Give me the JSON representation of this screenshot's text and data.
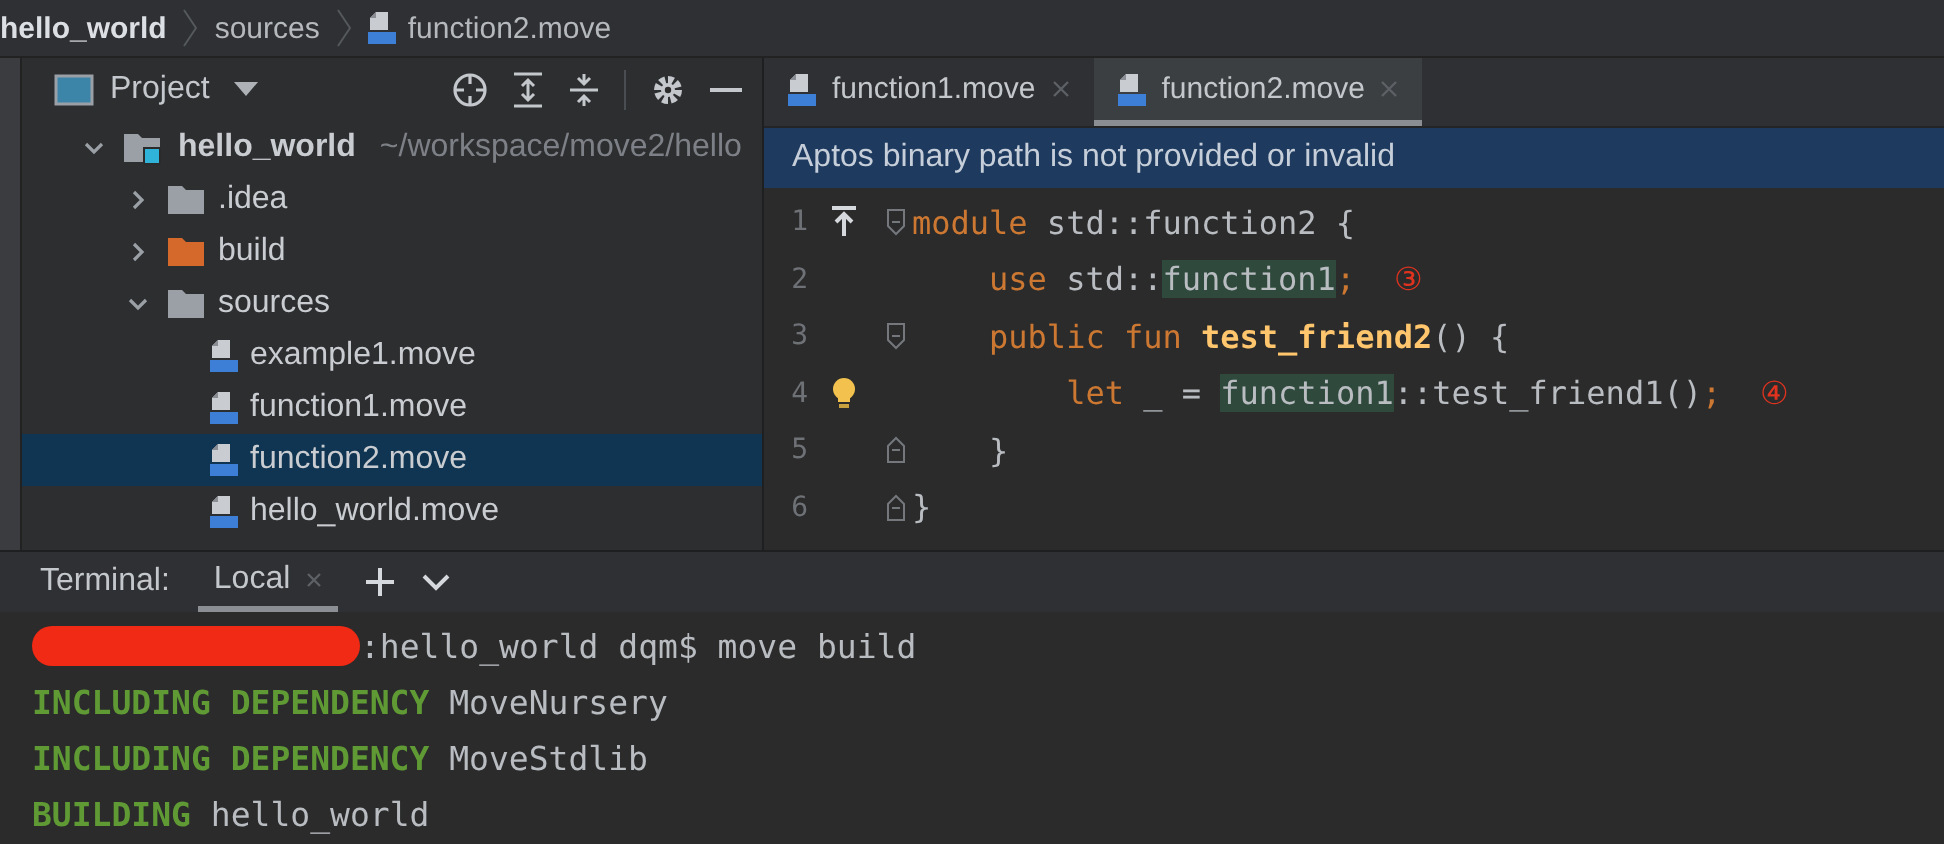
{
  "breadcrumbs": [
    {
      "label": "hello_world",
      "kind": "project"
    },
    {
      "label": "sources",
      "kind": "folder"
    },
    {
      "label": "function2.move",
      "kind": "move"
    }
  ],
  "project_panel": {
    "title": "Project",
    "tree": [
      {
        "label": "hello_world",
        "path": "~/workspace/move2/hello",
        "kind": "project",
        "expanded": true,
        "selected": false,
        "children": [
          {
            "label": ".idea",
            "kind": "folder",
            "expanded": false,
            "selected": false
          },
          {
            "label": "build",
            "kind": "excluded",
            "expanded": false,
            "selected": false
          },
          {
            "label": "sources",
            "kind": "folder",
            "expanded": true,
            "selected": false,
            "children": [
              {
                "label": "example1.move",
                "kind": "move",
                "selected": false
              },
              {
                "label": "function1.move",
                "kind": "move",
                "selected": false
              },
              {
                "label": "function2.move",
                "kind": "move",
                "selected": true
              },
              {
                "label": "hello_world.move",
                "kind": "move",
                "selected": false
              }
            ]
          }
        ]
      }
    ]
  },
  "editor": {
    "tabs": [
      {
        "label": "function1.move",
        "selected": false
      },
      {
        "label": "function2.move",
        "selected": true
      }
    ],
    "banner": "Aptos binary path is not provided or invalid",
    "lines": [
      {
        "number": "1",
        "fold_start": true,
        "fold_end": false,
        "navigate_mark": true,
        "intention_bulb": false,
        "tokens": [
          {
            "text": "module",
            "kind": "keyword"
          },
          {
            "text": " std::function2 {",
            "kind": "plain"
          }
        ]
      },
      {
        "number": "2",
        "fold_start": false,
        "fold_end": false,
        "navigate_mark": false,
        "intention_bulb": false,
        "tokens": [
          {
            "text": "    use",
            "kind": "keyword"
          },
          {
            "text": " std::",
            "kind": "plain"
          },
          {
            "text": "function1",
            "kind": "ref"
          },
          {
            "text": ";",
            "kind": "keyword"
          },
          {
            "text": "  ③",
            "kind": "annotation"
          }
        ]
      },
      {
        "number": "3",
        "fold_start": true,
        "fold_end": false,
        "navigate_mark": false,
        "intention_bulb": false,
        "tokens": [
          {
            "text": "    public fun ",
            "kind": "keyword"
          },
          {
            "text": "test_friend2",
            "kind": "function"
          },
          {
            "text": "() {",
            "kind": "plain"
          }
        ]
      },
      {
        "number": "4",
        "fold_start": false,
        "fold_end": false,
        "navigate_mark": false,
        "intention_bulb": true,
        "tokens": [
          {
            "text": "        let",
            "kind": "keyword"
          },
          {
            "text": " _ = ",
            "kind": "plain"
          },
          {
            "text": "function1",
            "kind": "ref"
          },
          {
            "text": "::test_friend1()",
            "kind": "plain"
          },
          {
            "text": ";",
            "kind": "keyword"
          },
          {
            "text": "  ④",
            "kind": "annotation"
          }
        ]
      },
      {
        "number": "5",
        "fold_start": false,
        "fold_end": true,
        "navigate_mark": false,
        "intention_bulb": false,
        "tokens": [
          {
            "text": "    }",
            "kind": "plain"
          }
        ]
      },
      {
        "number": "6",
        "fold_start": false,
        "fold_end": true,
        "navigate_mark": false,
        "intention_bulb": false,
        "tokens": [
          {
            "text": "}",
            "kind": "plain"
          }
        ]
      }
    ]
  },
  "terminal": {
    "label": "Terminal:",
    "tabs": [
      {
        "label": "Local",
        "selected": true
      }
    ],
    "lines": [
      {
        "redacted": true,
        "tokens": [
          {
            "text": ":hello_world dqm$ move build",
            "kind": "plain"
          }
        ]
      },
      {
        "redacted": false,
        "tokens": [
          {
            "text": "INCLUDING DEPENDENCY",
            "kind": "status"
          },
          {
            "text": " MoveNursery",
            "kind": "plain"
          }
        ]
      },
      {
        "redacted": false,
        "tokens": [
          {
            "text": "INCLUDING DEPENDENCY",
            "kind": "status"
          },
          {
            "text": " MoveStdlib",
            "kind": "plain"
          }
        ]
      },
      {
        "redacted": false,
        "tokens": [
          {
            "text": "BUILDING",
            "kind": "status"
          },
          {
            "text": " hello_world",
            "kind": "plain"
          }
        ]
      }
    ]
  }
}
